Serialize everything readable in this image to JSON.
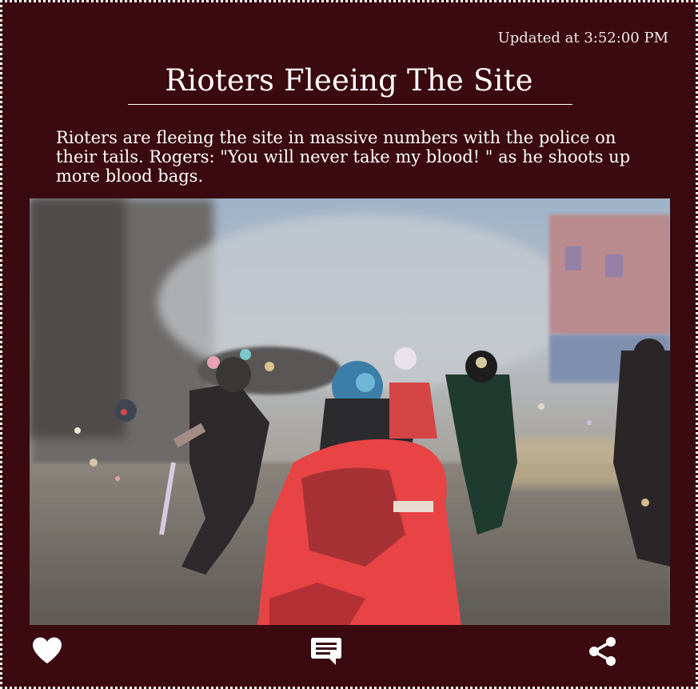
{
  "post": {
    "updated_text": "Updated at 3:52:00 PM",
    "title": "Rioters Fleeing The Site",
    "body": "Rioters are fleeing the site in massive numbers with the police on their tails. Rogers: \"You will never take my blood!  \" as he shoots up more blood bags."
  },
  "image": {
    "description_icon": "painted-riot-scene-image"
  },
  "actions": {
    "like_icon": "heart-icon",
    "comment_icon": "comment-icon",
    "share_icon": "share-icon"
  },
  "colors": {
    "background": "#3a0a10",
    "text": "#ffffff",
    "border": "#ffffff"
  }
}
